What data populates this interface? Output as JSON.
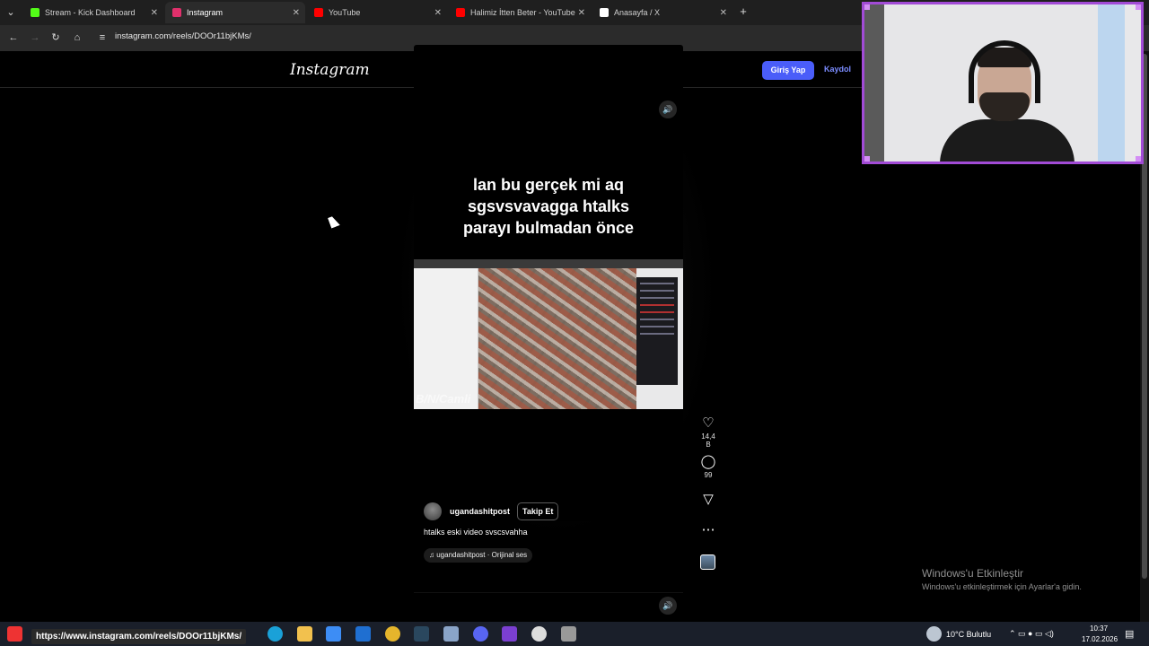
{
  "browser": {
    "tabs": [
      {
        "title": "Stream - Kick Dashboard",
        "favicon_color": "#53fc18",
        "active": false
      },
      {
        "title": "Instagram",
        "favicon_color": "#e1306c",
        "active": true
      },
      {
        "title": "YouTube",
        "favicon_color": "#ff0000",
        "active": false
      },
      {
        "title": "Halimiz İtten Beter - YouTube",
        "favicon_color": "#ff0000",
        "active": false
      },
      {
        "title": "Anasayfa / X",
        "favicon_color": "#ffffff",
        "active": false
      }
    ],
    "new_tab": "+",
    "url": "instagram.com/reels/DOOr11bjKMs/",
    "status_url": "https://www.instagram.com/reels/DOOr11bjKMs/"
  },
  "instagram": {
    "logo": "Instagram",
    "login_button": "Giriş Yap",
    "signup_link": "Kaydol"
  },
  "reel": {
    "caption_lines": [
      "lan bu gerçek mi aq",
      "sgsvsvavagga htalks",
      "parayı bulmadan önce"
    ],
    "watermark": "B/N/Camli",
    "likes": "14,4 B",
    "comments": "99",
    "username": "ugandashitpost",
    "follow_button": "Takip Et",
    "description": "htalks eski video svscsvahha",
    "audio": "ugandashitpost · Orijinal ses",
    "mute_icon": "speaker-icon"
  },
  "windows": {
    "activate_title": "Windows'u Etkinleştir",
    "activate_sub": "Windows'u etkinleştirmek için Ayarlar'a gidin.",
    "weather": "10°C  Bulutlu",
    "time": "10:37",
    "date": "17.02.2026"
  },
  "colors": {
    "webcam_border": "#a24bd6",
    "login_bg": "#4a5df9",
    "signup": "#7b8cff"
  }
}
